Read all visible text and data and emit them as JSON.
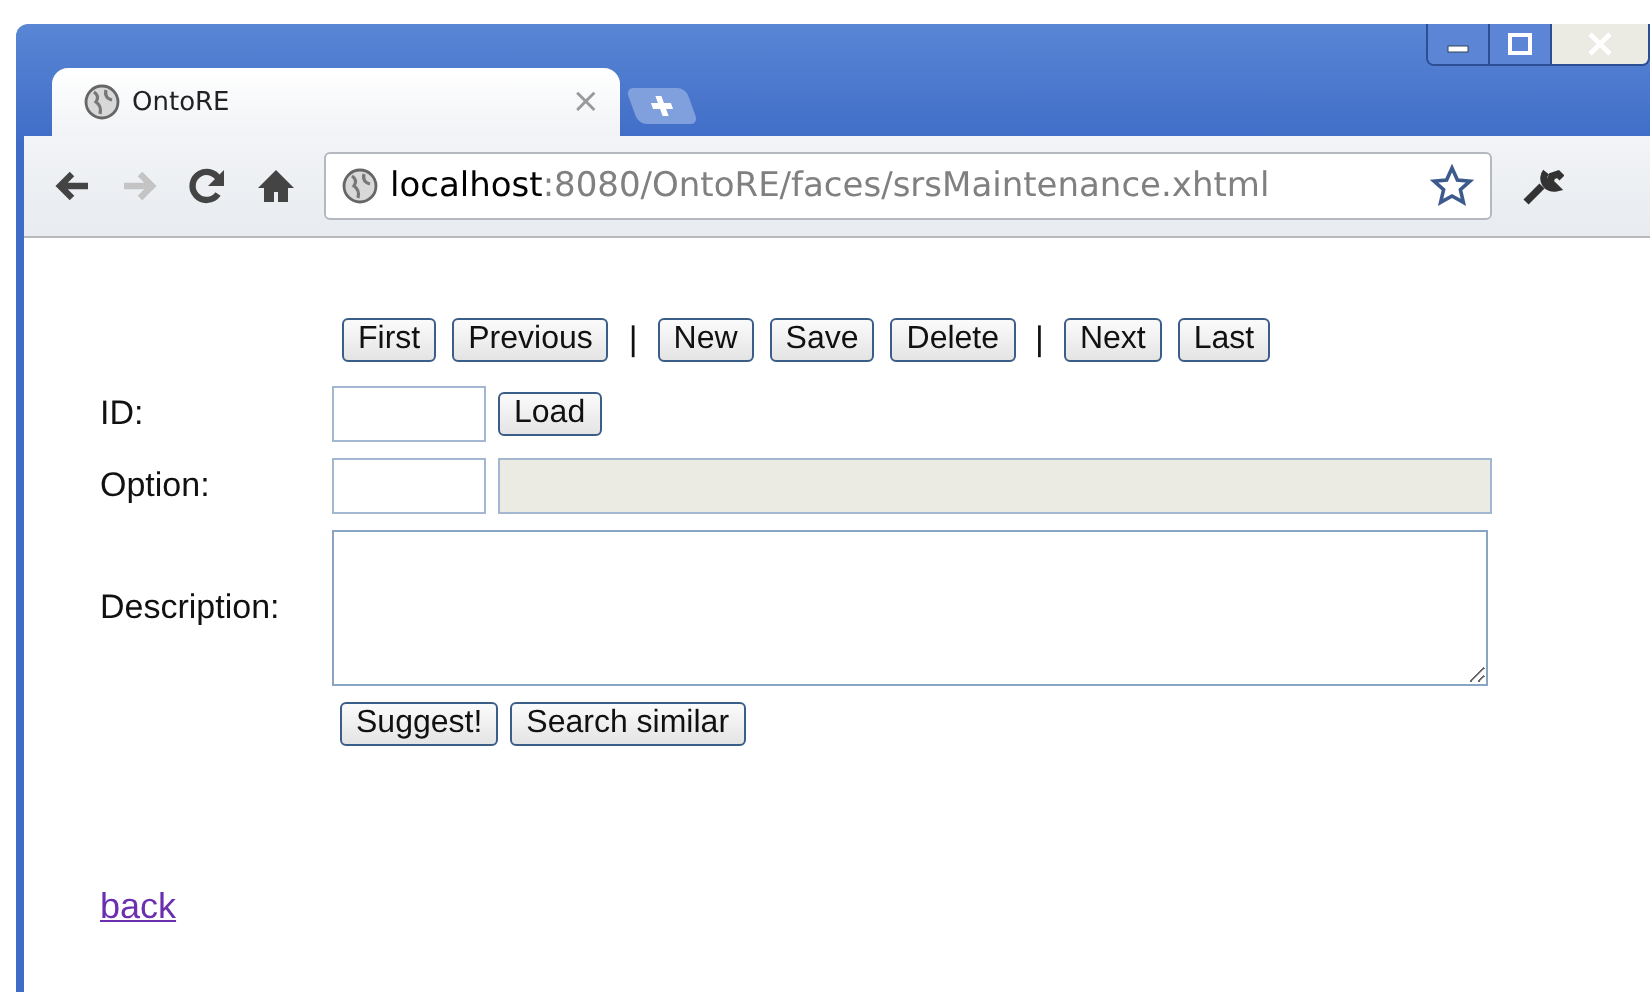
{
  "browser": {
    "tab": {
      "title": "OntoRE",
      "close": "×"
    },
    "address": {
      "host": "localhost",
      "path": ":8080/OntoRE/faces/srsMaintenance.xhtml"
    },
    "forward_disabled": true
  },
  "toolbar": [
    {
      "kind": "button",
      "label": "First"
    },
    {
      "kind": "button",
      "label": "Previous"
    },
    {
      "kind": "separator",
      "label": "|"
    },
    {
      "kind": "button",
      "label": "New"
    },
    {
      "kind": "button",
      "label": "Save"
    },
    {
      "kind": "button",
      "label": "Delete"
    },
    {
      "kind": "separator",
      "label": "|"
    },
    {
      "kind": "button",
      "label": "Next"
    },
    {
      "kind": "button",
      "label": "Last"
    }
  ],
  "form": {
    "id_label": "ID:",
    "load_button": "Load",
    "option_label": "Option:",
    "description_label": "Description:",
    "buttons": [
      "Suggest!",
      "Search similar"
    ]
  },
  "back_link": "back"
}
